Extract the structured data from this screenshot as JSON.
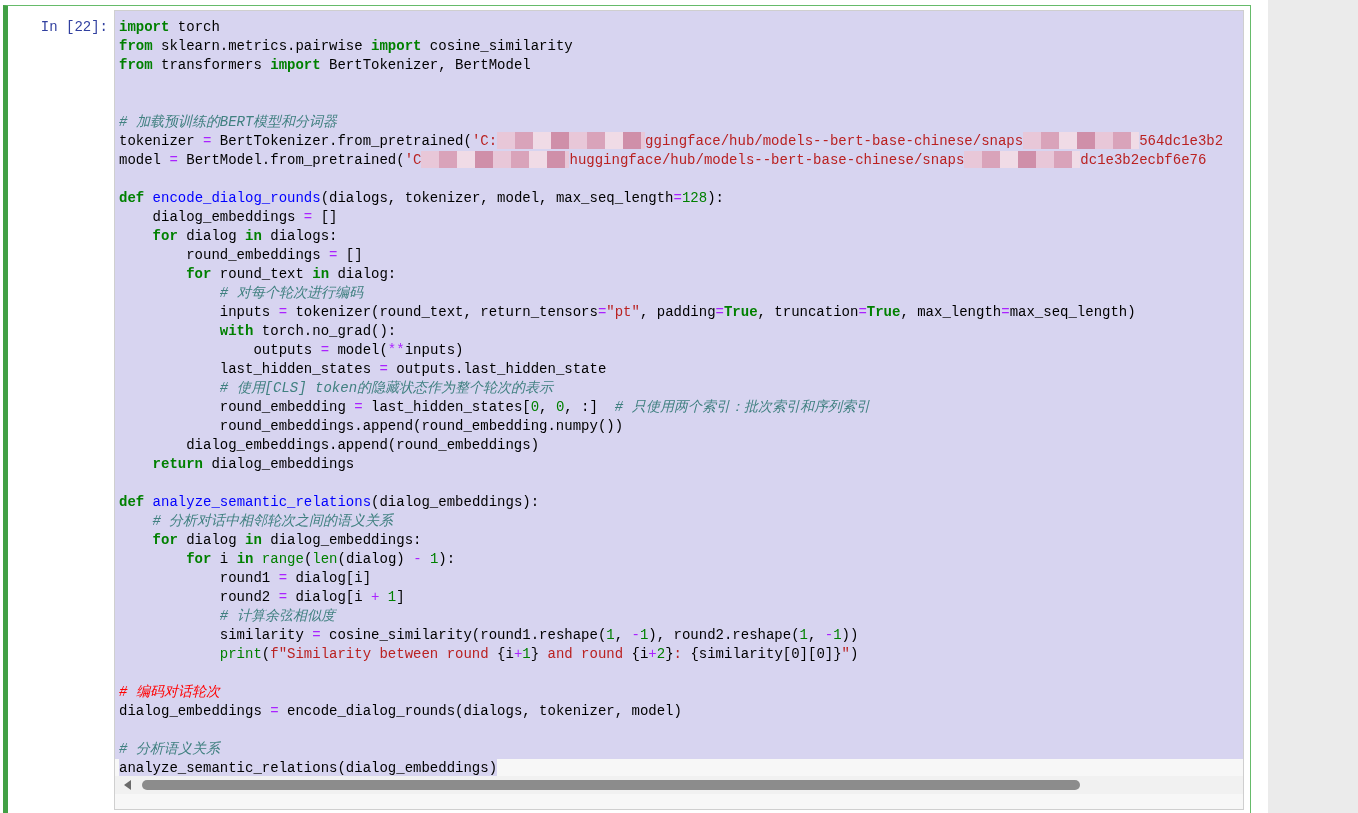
{
  "cell": {
    "prompt": "In [22]:",
    "selected": true,
    "lines": [
      {
        "selected": true,
        "full_row": true,
        "tokens": [
          {
            "kind": "kw",
            "text": "import"
          },
          {
            "kind": "p",
            "text": " torch"
          }
        ]
      },
      {
        "selected": true,
        "full_row": true,
        "tokens": [
          {
            "kind": "kw",
            "text": "from"
          },
          {
            "kind": "p",
            "text": " sklearn.metrics.pairwise "
          },
          {
            "kind": "kw",
            "text": "import"
          },
          {
            "kind": "p",
            "text": " cosine_similarity"
          }
        ]
      },
      {
        "selected": true,
        "full_row": true,
        "tokens": [
          {
            "kind": "kw",
            "text": "from"
          },
          {
            "kind": "p",
            "text": " transformers "
          },
          {
            "kind": "kw",
            "text": "import"
          },
          {
            "kind": "p",
            "text": " BertTokenizer, BertModel"
          }
        ]
      },
      {
        "selected": true,
        "full_row": true,
        "blank": true
      },
      {
        "selected": true,
        "full_row": true,
        "blank": true
      },
      {
        "selected": true,
        "full_row": true,
        "tokens": [
          {
            "kind": "cm",
            "text": "# 加载预训练的BERT模型和分词器"
          }
        ]
      },
      {
        "selected": true,
        "full_row": true,
        "tokens": [
          {
            "kind": "p",
            "text": "tokenizer "
          },
          {
            "kind": "op",
            "text": "="
          },
          {
            "kind": "p",
            "text": " BertTokenizer.from_pretrained("
          },
          {
            "kind": "str",
            "text": "'C:"
          },
          {
            "kind": "redacted",
            "wide": true
          },
          {
            "kind": "str",
            "text": "ggingface/hub/models--bert-base-chinese/snaps"
          },
          {
            "kind": "redacted",
            "wide": false
          },
          {
            "kind": "str",
            "text": "564dc1e3b2"
          }
        ]
      },
      {
        "selected": true,
        "full_row": true,
        "tokens": [
          {
            "kind": "p",
            "text": "model "
          },
          {
            "kind": "op",
            "text": "="
          },
          {
            "kind": "p",
            "text": " BertModel.from_pretrained("
          },
          {
            "kind": "str",
            "text": "'C"
          },
          {
            "kind": "redacted",
            "wide": true
          },
          {
            "kind": "str",
            "text": "huggingface/hub/models--bert-base-chinese/snaps"
          },
          {
            "kind": "redacted",
            "wide": false
          },
          {
            "kind": "str",
            "text": "dc1e3b2ecbf6e76"
          }
        ]
      },
      {
        "selected": true,
        "full_row": true,
        "blank": true
      },
      {
        "selected": true,
        "full_row": true,
        "tokens": [
          {
            "kind": "kw",
            "text": "def"
          },
          {
            "kind": "fn",
            "text": " encode_dialog_rounds"
          },
          {
            "kind": "p",
            "text": "(dialogs, tokenizer, model, max_seq_length"
          },
          {
            "kind": "op",
            "text": "="
          },
          {
            "kind": "num",
            "text": "128"
          },
          {
            "kind": "p",
            "text": "):"
          }
        ]
      },
      {
        "selected": true,
        "full_row": true,
        "tokens": [
          {
            "kind": "p",
            "text": "    dialog_embeddings "
          },
          {
            "kind": "op",
            "text": "="
          },
          {
            "kind": "p",
            "text": " []"
          }
        ]
      },
      {
        "selected": true,
        "full_row": true,
        "tokens": [
          {
            "kind": "kw",
            "text": "    for"
          },
          {
            "kind": "p",
            "text": " dialog "
          },
          {
            "kind": "kw",
            "text": "in"
          },
          {
            "kind": "p",
            "text": " dialogs:"
          }
        ]
      },
      {
        "selected": true,
        "full_row": true,
        "tokens": [
          {
            "kind": "p",
            "text": "        round_embeddings "
          },
          {
            "kind": "op",
            "text": "="
          },
          {
            "kind": "p",
            "text": " []"
          }
        ]
      },
      {
        "selected": true,
        "full_row": true,
        "tokens": [
          {
            "kind": "kw",
            "text": "        for"
          },
          {
            "kind": "p",
            "text": " round_text "
          },
          {
            "kind": "kw",
            "text": "in"
          },
          {
            "kind": "p",
            "text": " dialog:"
          }
        ]
      },
      {
        "selected": true,
        "full_row": true,
        "tokens": [
          {
            "kind": "cm",
            "text": "            # 对每个轮次进行编码"
          }
        ]
      },
      {
        "selected": true,
        "full_row": true,
        "tokens": [
          {
            "kind": "p",
            "text": "            inputs "
          },
          {
            "kind": "op",
            "text": "="
          },
          {
            "kind": "p",
            "text": " tokenizer(round_text, return_tensors"
          },
          {
            "kind": "op",
            "text": "="
          },
          {
            "kind": "str",
            "text": "\"pt\""
          },
          {
            "kind": "p",
            "text": ", padding"
          },
          {
            "kind": "op",
            "text": "="
          },
          {
            "kind": "kc",
            "text": "True"
          },
          {
            "kind": "p",
            "text": ", truncation"
          },
          {
            "kind": "op",
            "text": "="
          },
          {
            "kind": "kc",
            "text": "True"
          },
          {
            "kind": "p",
            "text": ", max_length"
          },
          {
            "kind": "op",
            "text": "="
          },
          {
            "kind": "p",
            "text": "max_seq_length)"
          }
        ]
      },
      {
        "selected": true,
        "full_row": true,
        "tokens": [
          {
            "kind": "kw",
            "text": "            with"
          },
          {
            "kind": "p",
            "text": " torch.no_grad():"
          }
        ]
      },
      {
        "selected": true,
        "full_row": true,
        "tokens": [
          {
            "kind": "p",
            "text": "                outputs "
          },
          {
            "kind": "op",
            "text": "="
          },
          {
            "kind": "p",
            "text": " model("
          },
          {
            "kind": "op",
            "text": "**"
          },
          {
            "kind": "p",
            "text": "inputs)"
          }
        ]
      },
      {
        "selected": true,
        "full_row": true,
        "tokens": [
          {
            "kind": "p",
            "text": "            last_hidden_states "
          },
          {
            "kind": "op",
            "text": "="
          },
          {
            "kind": "p",
            "text": " outputs.last_hidden_state"
          }
        ]
      },
      {
        "selected": true,
        "full_row": true,
        "tokens": [
          {
            "kind": "cm",
            "text": "            # 使用[CLS] token的隐藏状态作为整个轮次的表示"
          }
        ]
      },
      {
        "selected": true,
        "full_row": true,
        "tokens": [
          {
            "kind": "p",
            "text": "            round_embedding "
          },
          {
            "kind": "op",
            "text": "="
          },
          {
            "kind": "p",
            "text": " last_hidden_states["
          },
          {
            "kind": "num",
            "text": "0"
          },
          {
            "kind": "p",
            "text": ", "
          },
          {
            "kind": "num",
            "text": "0"
          },
          {
            "kind": "p",
            "text": ", :]  "
          },
          {
            "kind": "cm",
            "text": "# 只使用两个索引：批次索引和序列索引"
          }
        ]
      },
      {
        "selected": true,
        "full_row": true,
        "tokens": [
          {
            "kind": "p",
            "text": "            round_embeddings.append(round_embedding.numpy())"
          }
        ]
      },
      {
        "selected": true,
        "full_row": true,
        "tokens": [
          {
            "kind": "p",
            "text": "        dialog_embeddings.append(round_embeddings)"
          }
        ]
      },
      {
        "selected": true,
        "full_row": true,
        "tokens": [
          {
            "kind": "kw",
            "text": "    return"
          },
          {
            "kind": "p",
            "text": " dialog_embeddings"
          }
        ]
      },
      {
        "selected": true,
        "full_row": true,
        "blank": true
      },
      {
        "selected": true,
        "full_row": true,
        "tokens": [
          {
            "kind": "kw",
            "text": "def"
          },
          {
            "kind": "fn",
            "text": " analyze_semantic_relations"
          },
          {
            "kind": "p",
            "text": "(dialog_embeddings):"
          }
        ]
      },
      {
        "selected": true,
        "full_row": true,
        "tokens": [
          {
            "kind": "cm",
            "text": "    # 分析对话中相邻轮次之间的语义关系"
          }
        ]
      },
      {
        "selected": true,
        "full_row": true,
        "tokens": [
          {
            "kind": "kw",
            "text": "    for"
          },
          {
            "kind": "p",
            "text": " dialog "
          },
          {
            "kind": "kw",
            "text": "in"
          },
          {
            "kind": "p",
            "text": " dialog_embeddings:"
          }
        ]
      },
      {
        "selected": true,
        "full_row": true,
        "tokens": [
          {
            "kind": "kw",
            "text": "        for"
          },
          {
            "kind": "p",
            "text": " i "
          },
          {
            "kind": "kw",
            "text": "in"
          },
          {
            "kind": "bi",
            "text": " range"
          },
          {
            "kind": "p",
            "text": "("
          },
          {
            "kind": "bi",
            "text": "len"
          },
          {
            "kind": "p",
            "text": "(dialog) "
          },
          {
            "kind": "op",
            "text": "-"
          },
          {
            "kind": "num",
            "text": " 1"
          },
          {
            "kind": "p",
            "text": "):"
          }
        ]
      },
      {
        "selected": true,
        "full_row": true,
        "tokens": [
          {
            "kind": "p",
            "text": "            round1 "
          },
          {
            "kind": "op",
            "text": "="
          },
          {
            "kind": "p",
            "text": " dialog[i]"
          }
        ]
      },
      {
        "selected": true,
        "full_row": true,
        "tokens": [
          {
            "kind": "p",
            "text": "            round2 "
          },
          {
            "kind": "op",
            "text": "="
          },
          {
            "kind": "p",
            "text": " dialog[i "
          },
          {
            "kind": "op",
            "text": "+"
          },
          {
            "kind": "num",
            "text": " 1"
          },
          {
            "kind": "p",
            "text": "]"
          }
        ]
      },
      {
        "selected": true,
        "full_row": true,
        "tokens": [
          {
            "kind": "cm",
            "text": "            # 计算余弦相似度"
          }
        ]
      },
      {
        "selected": true,
        "full_row": true,
        "tokens": [
          {
            "kind": "p",
            "text": "            similarity "
          },
          {
            "kind": "op",
            "text": "="
          },
          {
            "kind": "p",
            "text": " cosine_similarity(round1.reshape("
          },
          {
            "kind": "num",
            "text": "1"
          },
          {
            "kind": "p",
            "text": ", "
          },
          {
            "kind": "op",
            "text": "-"
          },
          {
            "kind": "num",
            "text": "1"
          },
          {
            "kind": "p",
            "text": "), round2.reshape("
          },
          {
            "kind": "num",
            "text": "1"
          },
          {
            "kind": "p",
            "text": ", "
          },
          {
            "kind": "op",
            "text": "-"
          },
          {
            "kind": "num",
            "text": "1"
          },
          {
            "kind": "p",
            "text": "))"
          }
        ]
      },
      {
        "selected": true,
        "full_row": true,
        "tokens": [
          {
            "kind": "bi",
            "text": "            print"
          },
          {
            "kind": "p",
            "text": "("
          },
          {
            "kind": "str",
            "text": "f\"Similarity between round "
          },
          {
            "kind": "p",
            "text": "{i"
          },
          {
            "kind": "op",
            "text": "+"
          },
          {
            "kind": "num",
            "text": "1"
          },
          {
            "kind": "p",
            "text": "}"
          },
          {
            "kind": "str",
            "text": " and round "
          },
          {
            "kind": "p",
            "text": "{i"
          },
          {
            "kind": "op",
            "text": "+"
          },
          {
            "kind": "num",
            "text": "2"
          },
          {
            "kind": "p",
            "text": "}"
          },
          {
            "kind": "str",
            "text": ": "
          },
          {
            "kind": "p",
            "text": "{similarity[0][0]}"
          },
          {
            "kind": "str",
            "text": "\""
          },
          {
            "kind": "p",
            "text": ")"
          }
        ]
      },
      {
        "selected": true,
        "full_row": true,
        "blank": true
      },
      {
        "selected": true,
        "full_row": true,
        "tokens": [
          {
            "kind": "cmr",
            "text": "# 编码对话轮次"
          }
        ]
      },
      {
        "selected": true,
        "full_row": true,
        "tokens": [
          {
            "kind": "p",
            "text": "dialog_embeddings "
          },
          {
            "kind": "op",
            "text": "="
          },
          {
            "kind": "p",
            "text": " encode_dialog_rounds(dialogs, tokenizer, model)"
          }
        ]
      },
      {
        "selected": true,
        "full_row": true,
        "blank": true
      },
      {
        "selected": true,
        "full_row": true,
        "tokens": [
          {
            "kind": "cm",
            "text": "# 分析语义关系"
          }
        ]
      },
      {
        "selected": true,
        "full_row": false,
        "tokens": [
          {
            "kind": "p",
            "text": "analyze_semantic_relations(dialog_embeddings)"
          }
        ]
      }
    ]
  }
}
